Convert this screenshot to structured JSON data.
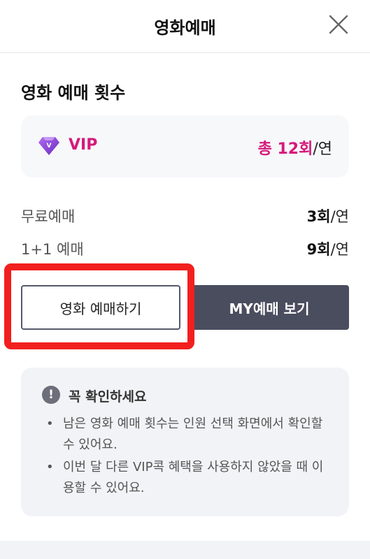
{
  "header": {
    "title": "영화예매"
  },
  "section": {
    "title": "영화 예매 횟수"
  },
  "vip_card": {
    "badge_letter": "V",
    "label": "VIP",
    "total_prefix": "총 12회",
    "total_unit": "/연",
    "accent_color": "#d6197b"
  },
  "rows": [
    {
      "label": "무료예매",
      "count": "3회",
      "unit": "/연"
    },
    {
      "label": "1+1 예매",
      "count": "9회",
      "unit": "/연"
    }
  ],
  "buttons": {
    "book": "영화 예매하기",
    "my_bookings": "MY예매 보기"
  },
  "notice": {
    "icon": "!",
    "title": "꼭 확인하세요",
    "items": [
      "남은 영화 예매 횟수는 인원 선택 화면에서 확인할 수 있어요.",
      "이번 달 다른 VIP콕 혜택을 사용하지 않았을 때 이용할 수 있어요."
    ]
  }
}
